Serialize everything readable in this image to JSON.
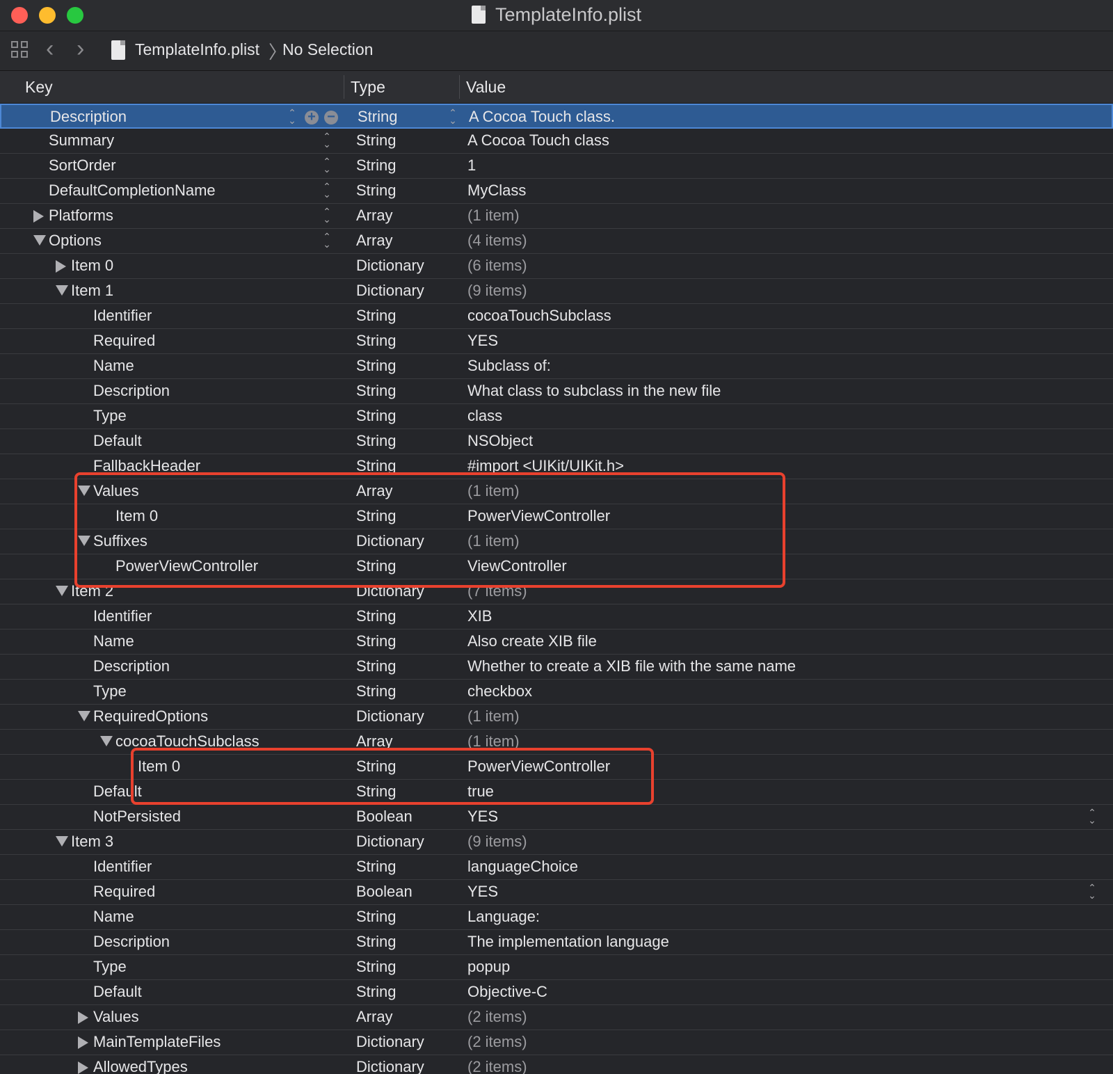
{
  "window": {
    "title": "TemplateInfo.plist"
  },
  "breadcrumb": {
    "file": "TemplateInfo.plist",
    "selection": "No Selection"
  },
  "columns": {
    "key": "Key",
    "type": "Type",
    "value": "Value"
  },
  "rows": [
    {
      "key": "Description",
      "type": "String",
      "value": "A Cocoa Touch class.",
      "indent": 0,
      "disclosure": "none",
      "selected": true
    },
    {
      "key": "Summary",
      "type": "String",
      "value": "A Cocoa Touch class",
      "indent": 0,
      "disclosure": "none"
    },
    {
      "key": "SortOrder",
      "type": "String",
      "value": "1",
      "indent": 0,
      "disclosure": "none"
    },
    {
      "key": "DefaultCompletionName",
      "type": "String",
      "value": "MyClass",
      "indent": 0,
      "disclosure": "none"
    },
    {
      "key": "Platforms",
      "type": "Array",
      "value": "(1 item)",
      "indent": 0,
      "disclosure": "closed",
      "dim": true
    },
    {
      "key": "Options",
      "type": "Array",
      "value": "(4 items)",
      "indent": 0,
      "disclosure": "open",
      "dim": true
    },
    {
      "key": "Item 0",
      "type": "Dictionary",
      "value": "(6 items)",
      "indent": 1,
      "disclosure": "closed",
      "dim": true
    },
    {
      "key": "Item 1",
      "type": "Dictionary",
      "value": "(9 items)",
      "indent": 1,
      "disclosure": "open",
      "dim": true
    },
    {
      "key": "Identifier",
      "type": "String",
      "value": "cocoaTouchSubclass",
      "indent": 2,
      "disclosure": "none"
    },
    {
      "key": "Required",
      "type": "String",
      "value": "YES",
      "indent": 2,
      "disclosure": "none"
    },
    {
      "key": "Name",
      "type": "String",
      "value": "Subclass of:",
      "indent": 2,
      "disclosure": "none"
    },
    {
      "key": "Description",
      "type": "String",
      "value": "What class to subclass in the new file",
      "indent": 2,
      "disclosure": "none"
    },
    {
      "key": "Type",
      "type": "String",
      "value": "class",
      "indent": 2,
      "disclosure": "none"
    },
    {
      "key": "Default",
      "type": "String",
      "value": "NSObject",
      "indent": 2,
      "disclosure": "none"
    },
    {
      "key": "FallbackHeader",
      "type": "String",
      "value": "#import <UIKit/UIKit.h>",
      "indent": 2,
      "disclosure": "none"
    },
    {
      "key": "Values",
      "type": "Array",
      "value": "(1 item)",
      "indent": 2,
      "disclosure": "open",
      "dim": true
    },
    {
      "key": "Item 0",
      "type": "String",
      "value": "PowerViewController",
      "indent": 3,
      "disclosure": "none"
    },
    {
      "key": "Suffixes",
      "type": "Dictionary",
      "value": "(1 item)",
      "indent": 2,
      "disclosure": "open",
      "dim": true
    },
    {
      "key": "PowerViewController",
      "type": "String",
      "value": "ViewController",
      "indent": 3,
      "disclosure": "none"
    },
    {
      "key": "Item 2",
      "type": "Dictionary",
      "value": "(7 items)",
      "indent": 1,
      "disclosure": "open",
      "dim": true
    },
    {
      "key": "Identifier",
      "type": "String",
      "value": "XIB",
      "indent": 2,
      "disclosure": "none"
    },
    {
      "key": "Name",
      "type": "String",
      "value": "Also create XIB file",
      "indent": 2,
      "disclosure": "none"
    },
    {
      "key": "Description",
      "type": "String",
      "value": "Whether to create a XIB file with the same name",
      "indent": 2,
      "disclosure": "none"
    },
    {
      "key": "Type",
      "type": "String",
      "value": "checkbox",
      "indent": 2,
      "disclosure": "none"
    },
    {
      "key": "RequiredOptions",
      "type": "Dictionary",
      "value": "(1 item)",
      "indent": 2,
      "disclosure": "open",
      "dim": true
    },
    {
      "key": "cocoaTouchSubclass",
      "type": "Array",
      "value": "(1 item)",
      "indent": 3,
      "disclosure": "open",
      "dim": true
    },
    {
      "key": "Item 0",
      "type": "String",
      "value": "PowerViewController",
      "indent": 4,
      "disclosure": "none"
    },
    {
      "key": "Default",
      "type": "String",
      "value": "true",
      "indent": 2,
      "disclosure": "none"
    },
    {
      "key": "NotPersisted",
      "type": "Boolean",
      "value": "YES",
      "indent": 2,
      "disclosure": "none",
      "valueStepper": true
    },
    {
      "key": "Item 3",
      "type": "Dictionary",
      "value": "(9 items)",
      "indent": 1,
      "disclosure": "open",
      "dim": true
    },
    {
      "key": "Identifier",
      "type": "String",
      "value": "languageChoice",
      "indent": 2,
      "disclosure": "none"
    },
    {
      "key": "Required",
      "type": "Boolean",
      "value": "YES",
      "indent": 2,
      "disclosure": "none",
      "valueStepper": true
    },
    {
      "key": "Name",
      "type": "String",
      "value": "Language:",
      "indent": 2,
      "disclosure": "none"
    },
    {
      "key": "Description",
      "type": "String",
      "value": "The implementation language",
      "indent": 2,
      "disclosure": "none"
    },
    {
      "key": "Type",
      "type": "String",
      "value": "popup",
      "indent": 2,
      "disclosure": "none"
    },
    {
      "key": "Default",
      "type": "String",
      "value": "Objective-C",
      "indent": 2,
      "disclosure": "none"
    },
    {
      "key": "Values",
      "type": "Array",
      "value": "(2 items)",
      "indent": 2,
      "disclosure": "closed",
      "dim": true
    },
    {
      "key": "MainTemplateFiles",
      "type": "Dictionary",
      "value": "(2 items)",
      "indent": 2,
      "disclosure": "closed",
      "dim": true
    },
    {
      "key": "AllowedTypes",
      "type": "Dictionary",
      "value": "(2 items)",
      "indent": 2,
      "disclosure": "closed",
      "dim": true
    }
  ],
  "highlights": [
    {
      "firstRow": 15,
      "lastRow": 18,
      "color": "#e8412e"
    },
    {
      "firstRow": 26,
      "lastRow": 27,
      "color": "#e8412e"
    }
  ],
  "colors": {
    "selection": "#2e5b93",
    "annotation": "#e8412e"
  }
}
